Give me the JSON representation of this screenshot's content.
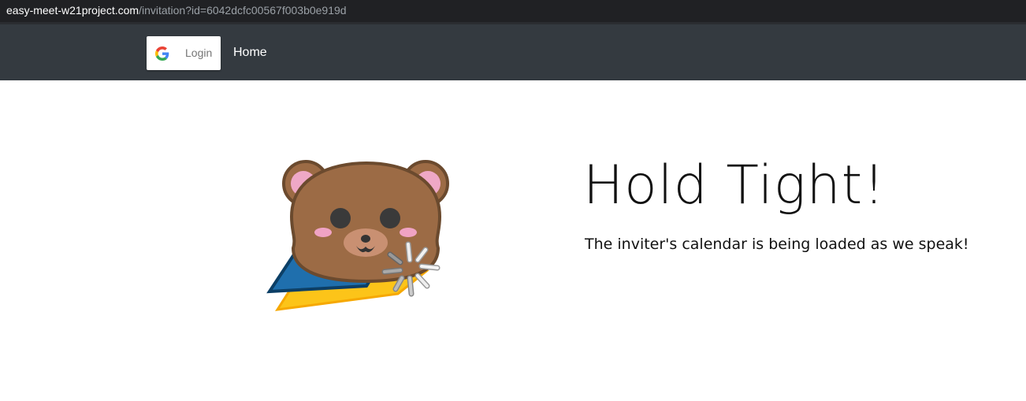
{
  "browser": {
    "url_host": "easy-meet-w21project.com",
    "url_path": "/invitation?id=6042dcfc00567f003b0e919d"
  },
  "nav": {
    "login_label": "Login",
    "home_label": "Home",
    "login_icon": "google-icon"
  },
  "main": {
    "title": "Hold Tight!",
    "subtitle": "The inviter's calendar is being loaded as we speak!",
    "illustration": "bear-loading-illustration"
  }
}
